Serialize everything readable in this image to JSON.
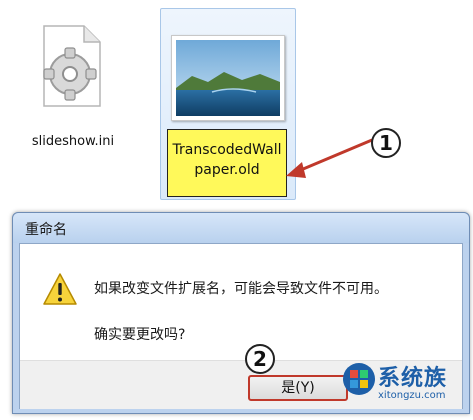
{
  "files": [
    {
      "name": "slideshow.ini",
      "icon": "ini-settings-file-icon"
    },
    {
      "name_line1": "TranscodedWall",
      "name_line2": "paper.old",
      "icon": "image-file-icon"
    }
  ],
  "callouts": {
    "step1": "1",
    "step2": "2"
  },
  "dialog": {
    "title": "重命名",
    "message": "如果改变文件扩展名，可能会导致文件不可用。",
    "question": "确实要更改吗?",
    "yes_button": "是(Y)"
  },
  "watermark": {
    "brand": "系统族",
    "url": "xitongzu.com"
  },
  "colors": {
    "highlight": "#fff95a",
    "callout_border": "#222222",
    "annotation_arrow": "#c0392b",
    "dialog_frame": "#bcd2ee"
  }
}
